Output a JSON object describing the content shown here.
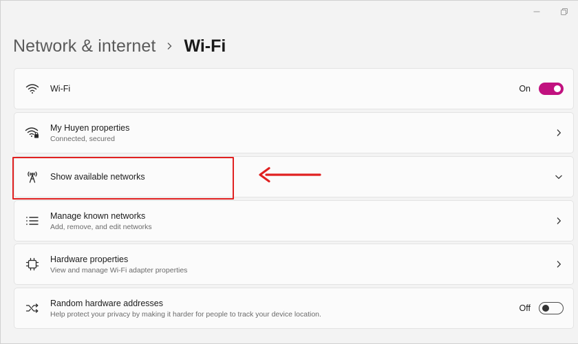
{
  "breadcrumb": {
    "parent": "Network & internet",
    "current": "Wi-Fi"
  },
  "rows": [
    {
      "title": "Wi-Fi",
      "toggle_label": "On",
      "toggle_state": "on",
      "icon": "wifi-icon"
    },
    {
      "title": "My Huyen properties",
      "subtitle": "Connected, secured",
      "icon": "wifi-secured-icon"
    },
    {
      "title": "Show available networks",
      "icon": "antenna-icon"
    },
    {
      "title": "Manage known networks",
      "subtitle": "Add, remove, and edit networks",
      "icon": "list-icon"
    },
    {
      "title": "Hardware properties",
      "subtitle": "View and manage Wi-Fi adapter properties",
      "icon": "chip-icon"
    },
    {
      "title": "Random hardware addresses",
      "subtitle": "Help protect your privacy by making it harder for people to track your device location.",
      "toggle_label": "Off",
      "toggle_state": "off",
      "icon": "shuffle-icon"
    }
  ],
  "colors": {
    "accent": "#c1117f",
    "annotation": "#e02020"
  }
}
